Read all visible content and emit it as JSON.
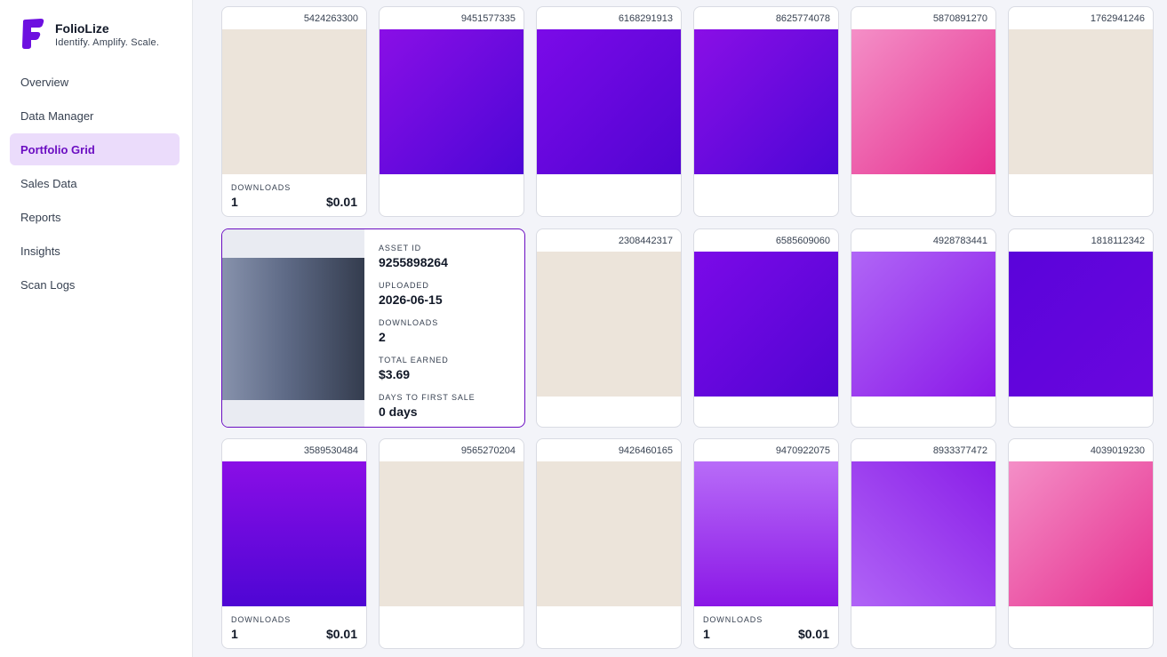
{
  "app": {
    "name": "FolioLize",
    "tagline": "Identify. Amplify. Scale.",
    "logo_icon": "folio-f-logo-icon",
    "accent": "#6b0ec2"
  },
  "nav": [
    {
      "label": "Overview",
      "active": false
    },
    {
      "label": "Data Manager",
      "active": false
    },
    {
      "label": "Portfolio Grid",
      "active": true
    },
    {
      "label": "Sales Data",
      "active": false
    },
    {
      "label": "Reports",
      "active": false
    },
    {
      "label": "Insights",
      "active": false
    },
    {
      "label": "Scan Logs",
      "active": false
    }
  ],
  "grid": {
    "cards": [
      {
        "id": "5424263300",
        "color": "#ece4da",
        "downloads_label": "DOWNLOADS",
        "downloads": "1",
        "earned": "$0.01"
      },
      {
        "id": "9451577335",
        "color": "#6a08e0"
      },
      {
        "id": "6168291913",
        "color": "#6606de"
      },
      {
        "id": "8625774078",
        "color": "#6c08e0"
      },
      {
        "id": "5870891270",
        "color": "#ef6fb2"
      },
      {
        "id": "1762941246",
        "color": "#ece4da"
      },
      {
        "id": "2308442317",
        "color": "#ece4da"
      },
      {
        "id": "6585609060",
        "color": "#6606de"
      },
      {
        "id": "4928783441",
        "color": "#9d3ef0"
      },
      {
        "id": "1818112342",
        "color": "#5e06dc"
      },
      {
        "id": "3589530484",
        "color": "#6c0ae2",
        "downloads_label": "DOWNLOADS",
        "downloads": "1",
        "earned": "$0.01"
      },
      {
        "id": "9565270204",
        "color": "#ece4da"
      },
      {
        "id": "9426460165",
        "color": "#ece4da"
      },
      {
        "id": "9470922075",
        "color": "#a144f2",
        "downloads_label": "DOWNLOADS",
        "downloads": "1",
        "earned": "$0.01"
      },
      {
        "id": "8933377472",
        "color": "#9d40f0"
      },
      {
        "id": "4039019230",
        "color": "#ef6fb2"
      }
    ]
  },
  "selected": {
    "asset_id_label": "ASSET ID",
    "asset_id": "9255898264",
    "uploaded_label": "UPLOADED",
    "uploaded": "2026-06-15",
    "downloads_label": "DOWNLOADS",
    "downloads": "2",
    "earned_label": "TOTAL EARNED",
    "earned": "$3.69",
    "days_label": "DAYS TO FIRST SALE",
    "days": "0 days"
  }
}
